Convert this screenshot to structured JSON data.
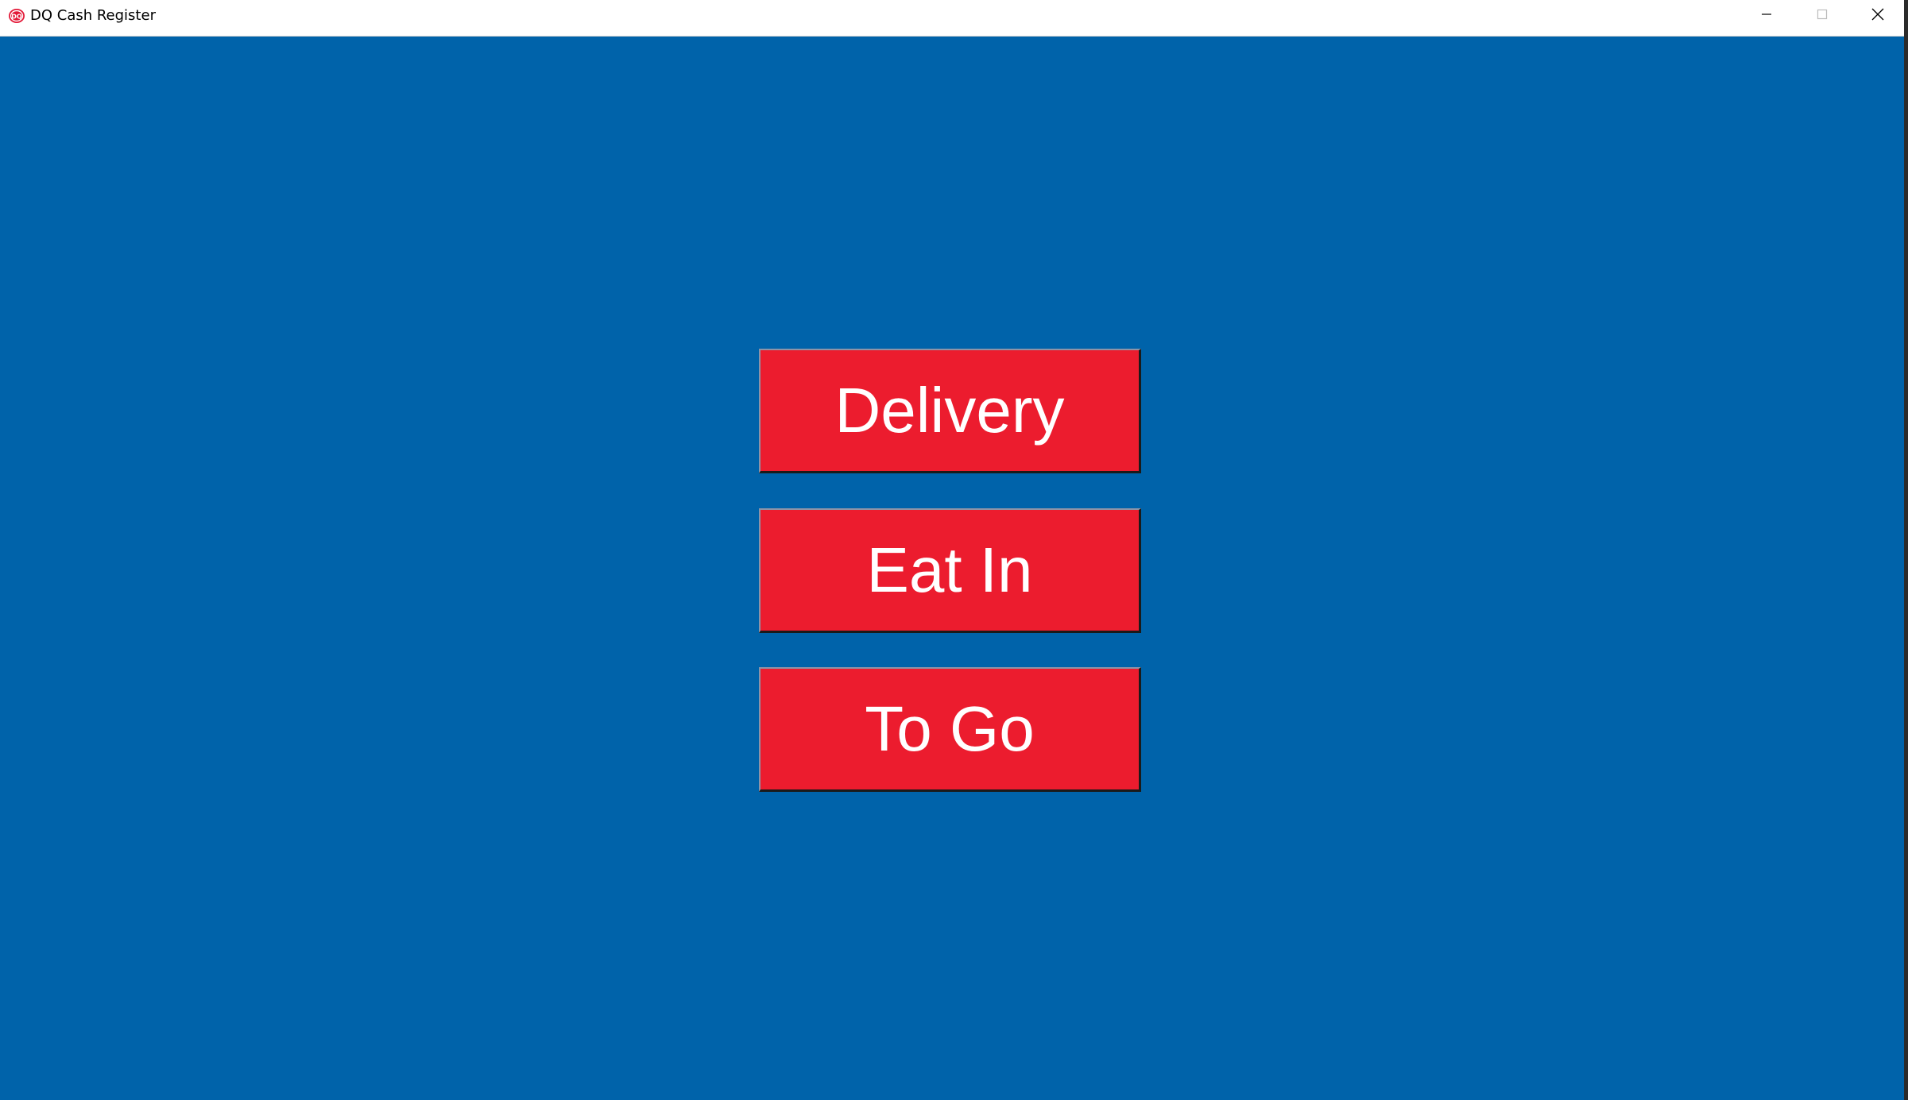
{
  "window": {
    "title": "DQ Cash Register",
    "app_icon": "dq-logo-icon",
    "controls": [
      "minimize-icon",
      "maximize-icon",
      "close-icon"
    ]
  },
  "colors": {
    "background": "#0063aa",
    "button": "#ec1c2e",
    "button_text": "#ffffff"
  },
  "order_types": {
    "delivery": "Delivery",
    "eat_in": "Eat In",
    "to_go": "To Go"
  }
}
